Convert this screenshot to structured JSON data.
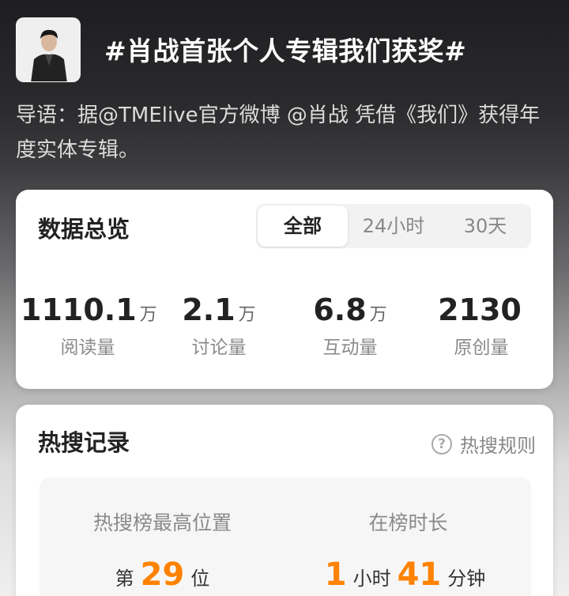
{
  "topic": {
    "title": "#肖战首张个人专辑我们获奖#",
    "intro": "导语：据@TMElive官方微博 @肖战 凭借《我们》获得年度实体专辑。"
  },
  "overview": {
    "title": "数据总览",
    "tabs": [
      {
        "label": "全部",
        "active": true
      },
      {
        "label": "24小时",
        "active": false
      },
      {
        "label": "30天",
        "active": false
      }
    ],
    "stats": [
      {
        "value": "1110.1",
        "unit": "万",
        "label": "阅读量"
      },
      {
        "value": "2.1",
        "unit": "万",
        "label": "讨论量"
      },
      {
        "value": "6.8",
        "unit": "万",
        "label": "互动量"
      },
      {
        "value": "2130",
        "unit": "",
        "label": "原创量"
      }
    ]
  },
  "hot_search": {
    "title": "热搜记录",
    "rules_label": "热搜规则",
    "help_icon": "?",
    "peak": {
      "label": "热搜榜最高位置",
      "prefix": "第",
      "value": "29",
      "suffix": "位"
    },
    "duration": {
      "label": "在榜时长",
      "hours": "1",
      "hours_unit": "小时",
      "minutes": "41",
      "minutes_unit": "分钟"
    }
  },
  "colors": {
    "accent": "#ff8200"
  }
}
